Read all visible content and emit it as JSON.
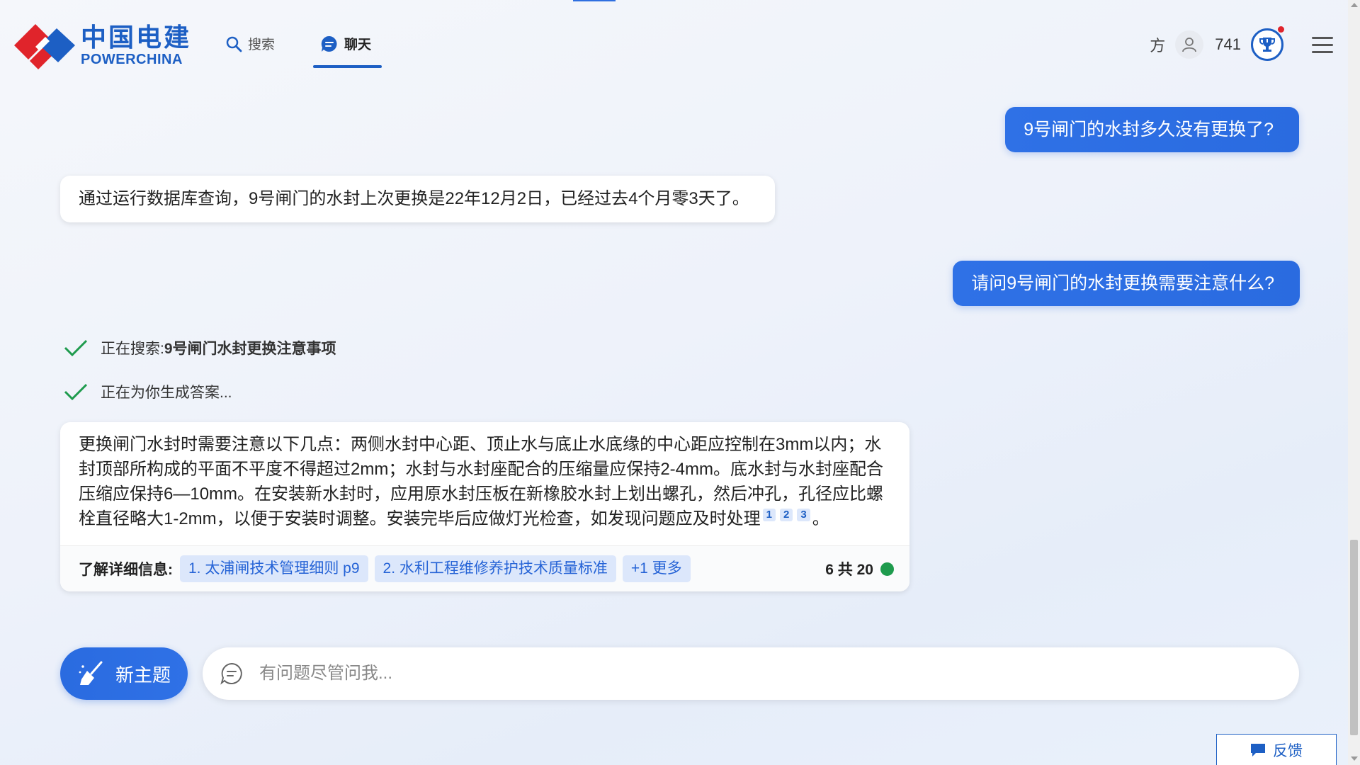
{
  "header": {
    "logo_cn": "中国电建",
    "logo_en": "POWERCHINA",
    "nav": [
      {
        "label": "搜索",
        "active": false
      },
      {
        "label": "聊天",
        "active": true
      }
    ],
    "user_initial": "方",
    "points": "741",
    "accent_color": "#1d5fc4"
  },
  "chat": {
    "messages": [
      {
        "role": "user",
        "text": "9号闸门的水封多久没有更换了?"
      },
      {
        "role": "assistant",
        "text": "通过运行数据库查询，9号闸门的水封上次更换是22年12月2日，已经过去4个月零3天了。"
      },
      {
        "role": "user",
        "text": "请问9号闸门的水封更换需要注意什么?"
      }
    ],
    "status": [
      {
        "prefix": "正在搜索: ",
        "query": "9号闸门水封更换注意事项"
      },
      {
        "prefix": "正在为你生成答案...",
        "query": ""
      }
    ],
    "answer": {
      "text": "更换闸门水封时需要注意以下几点：两侧水封中心距、顶止水与底止水底缘的中心距应控制在3mm以内；水封顶部所构成的平面不平度不得超过2mm；水封与水封座配合的压缩量应保持2-4mm。底水封与水封座配合压缩应保持6—10mm。在安装新水封时，应用原水封压板在新橡胶水封上划出螺孔，然后冲孔，孔径应比螺栓直径略大1-2mm，以便于安装时调整。安装完毕后应做灯光检查，如发现问题应及时处理",
      "citations": [
        "1",
        "2",
        "3"
      ],
      "end_punct": "。",
      "footer_label": "了解详细信息:",
      "references": [
        "1. 太浦闸技术管理细则 p9",
        "2. 水利工程维修养护技术质量标准",
        "+1 更多"
      ],
      "page_count": "6 共 20",
      "status_color": "#1e9b4d"
    }
  },
  "input": {
    "new_topic_label": "新主题",
    "placeholder": "有问题尽管问我..."
  },
  "feedback_label": "反馈"
}
